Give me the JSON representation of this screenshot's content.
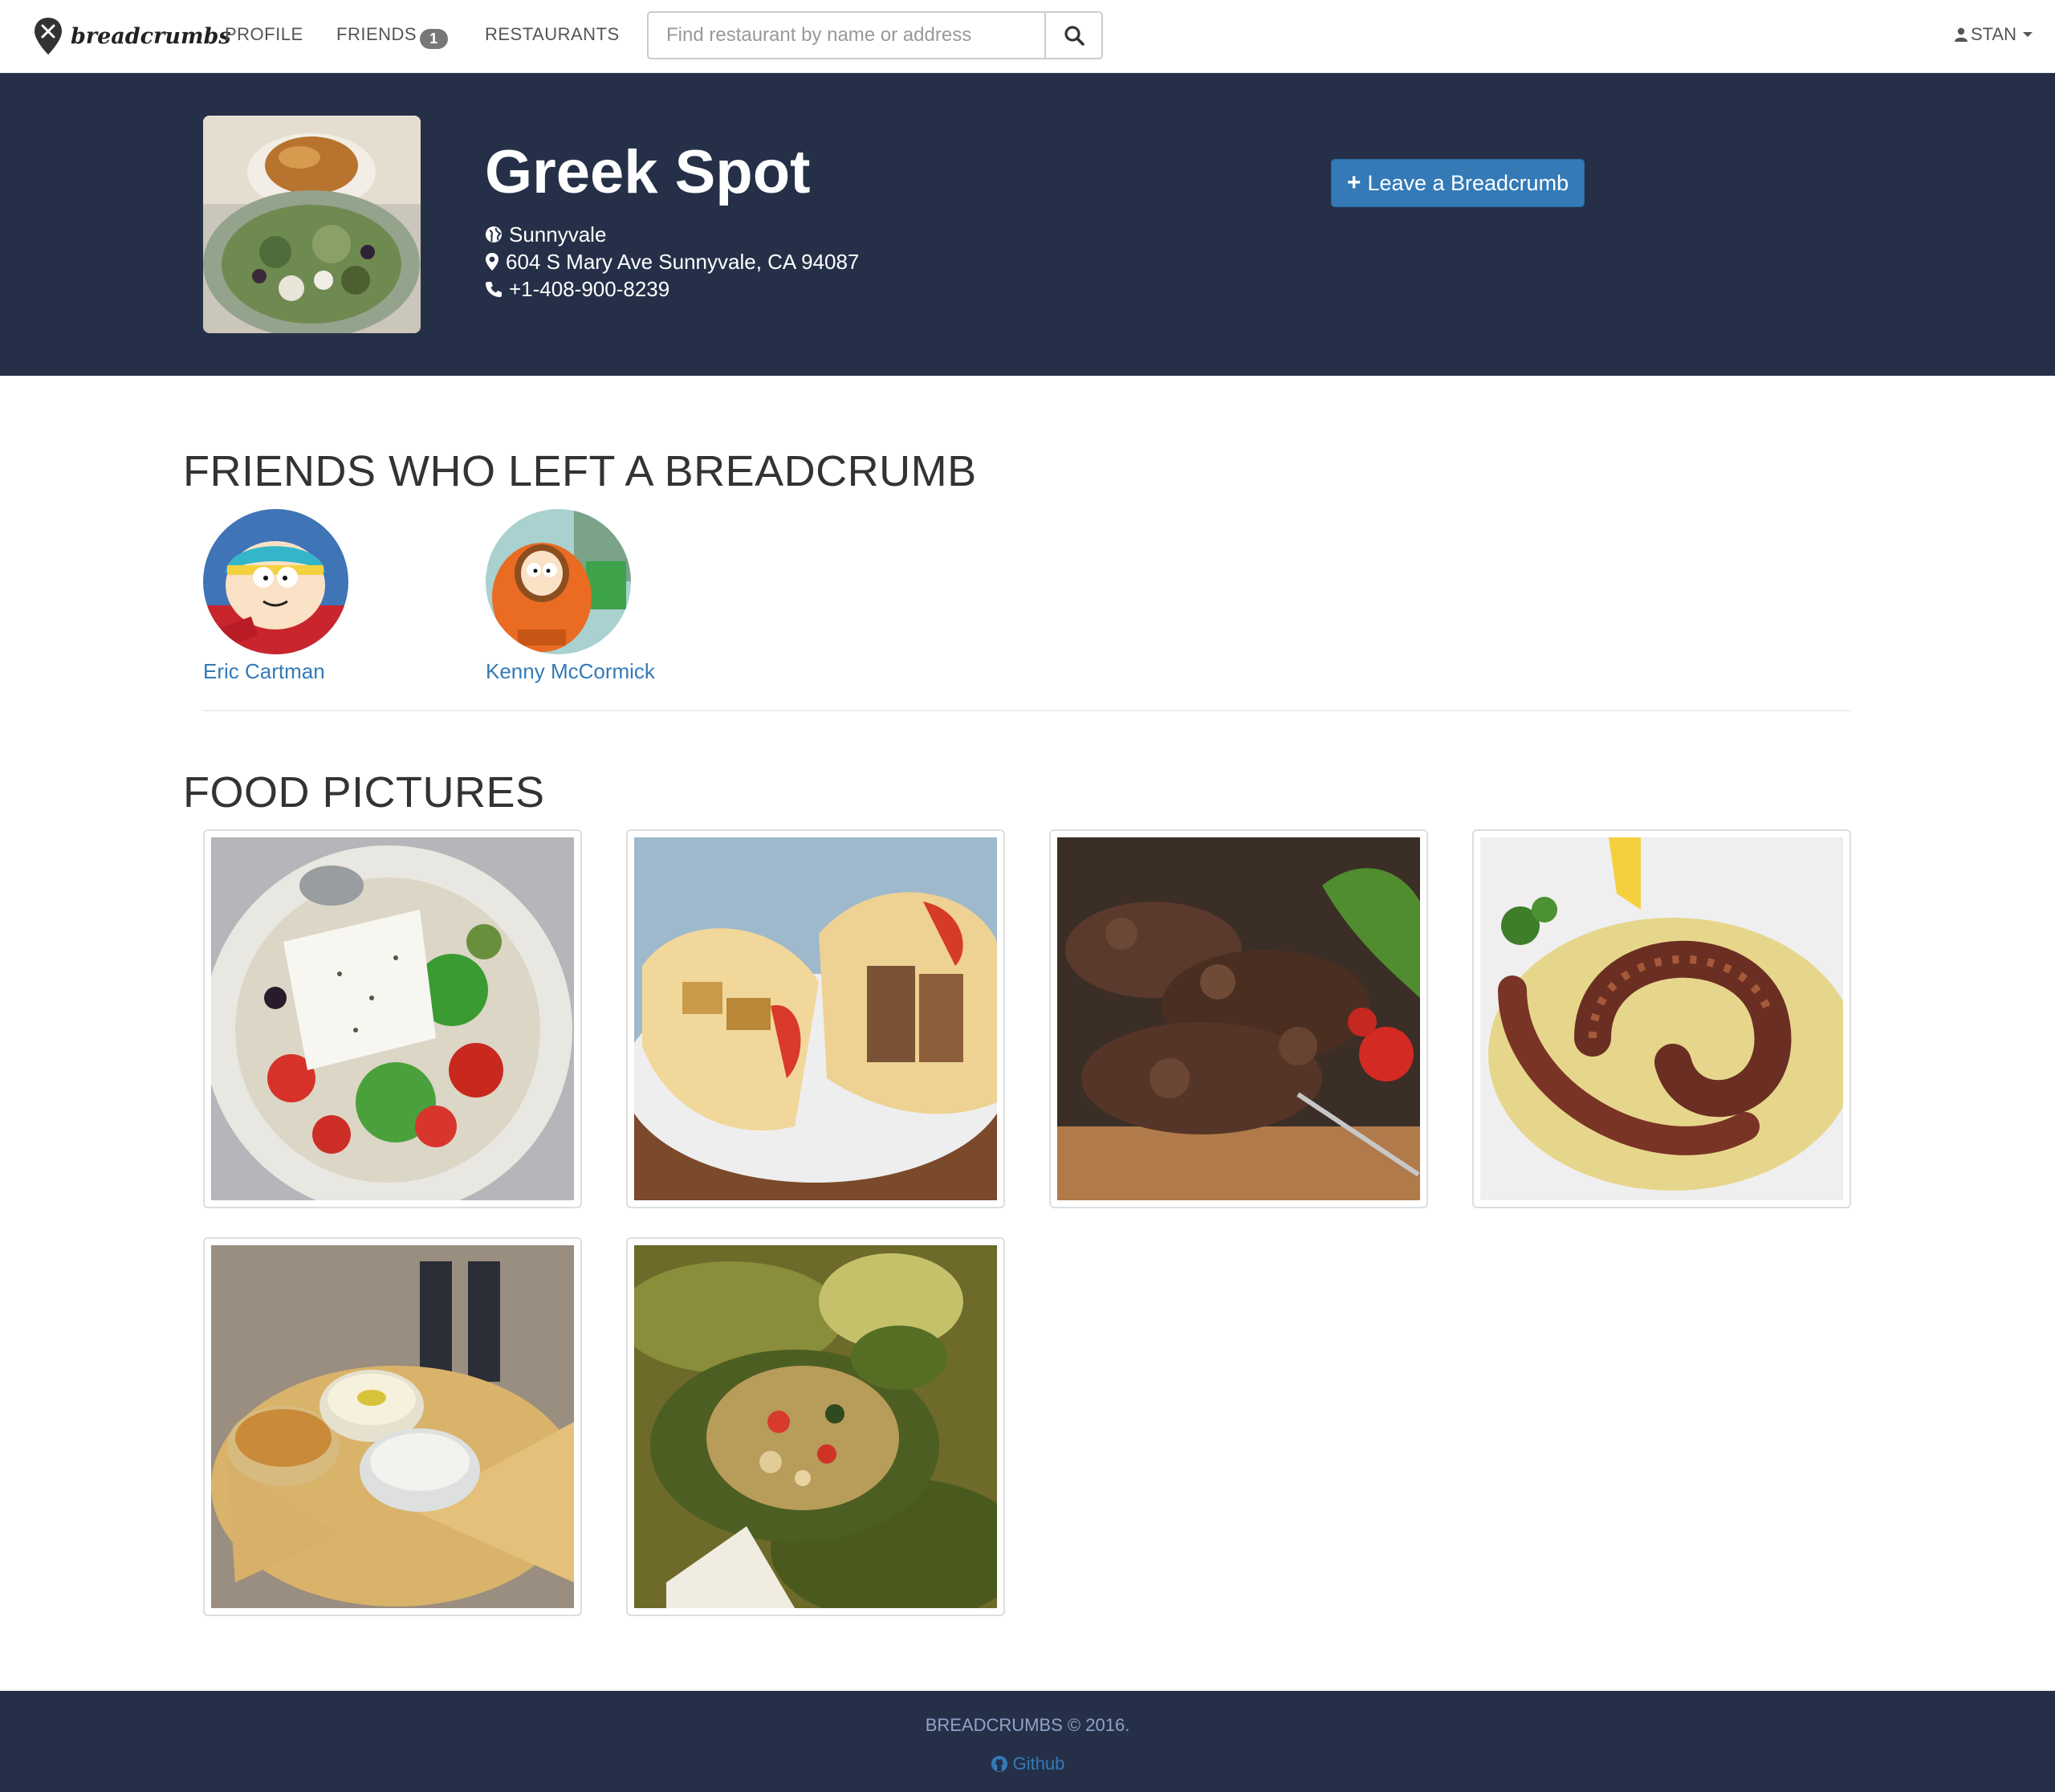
{
  "navbar": {
    "brand": "breadcrumbs",
    "links": {
      "profile": "PROFILE",
      "friends": "FRIENDS",
      "restaurants": "RESTAURANTS"
    },
    "friends_badge": "1",
    "search_placeholder": "Find restaurant by name or address",
    "user": "STAN"
  },
  "restaurant": {
    "name": "Greek Spot",
    "city": "Sunnyvale",
    "address": "604 S Mary Ave Sunnyvale, CA 94087",
    "phone": "+1-408-900-8239",
    "action_label": "Leave a Breadcrumb"
  },
  "friends_section": {
    "title": "FRIENDS WHO LEFT A BREADCRUMB",
    "friends": [
      {
        "name": "Eric Cartman"
      },
      {
        "name": "Kenny McCormick"
      }
    ]
  },
  "food_section": {
    "title": "FOOD PICTURES",
    "pictures": [
      "greek-salad",
      "gyros",
      "souvlaki-skewers",
      "grilled-octopus",
      "pita-dips",
      "dolmades"
    ]
  },
  "footer": {
    "copyright": "BREADCRUMBS © 2016.",
    "link": "Github"
  },
  "colors": {
    "header_bg": "#253048",
    "accent": "#337ab7"
  }
}
